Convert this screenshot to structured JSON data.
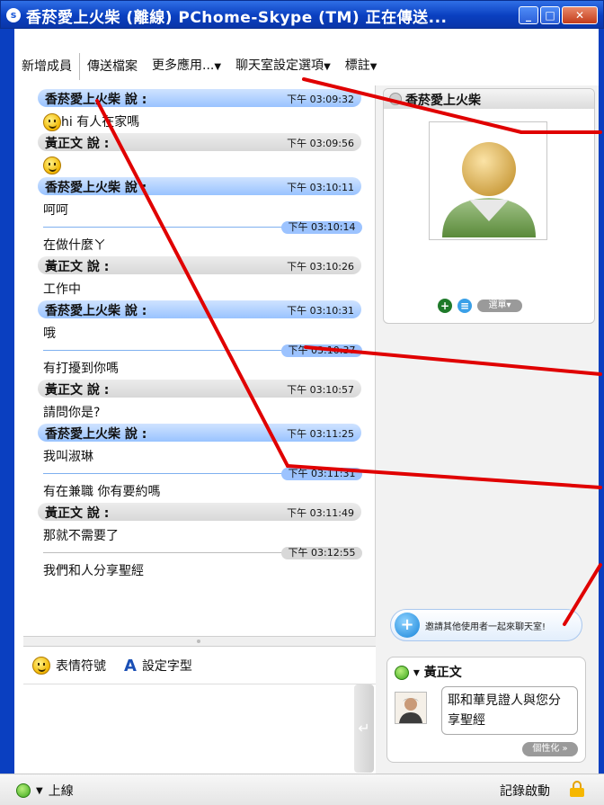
{
  "window": {
    "title": "香菸愛上火柴 (離線) PChome-Skype (TM) 正在傳送..."
  },
  "menu": {
    "items": [
      "新增成員",
      "傳送檔案",
      "更多應用...",
      "聊天室設定選項",
      "標註"
    ]
  },
  "chat": {
    "messages": [
      {
        "kind": "head",
        "side": "me",
        "name": "香菸愛上火柴 說 :",
        "time": "下午 03:09:32"
      },
      {
        "kind": "text",
        "text": "hi   有人在家嗎",
        "emoticon": "smile-icon"
      },
      {
        "kind": "head",
        "side": "other",
        "name": "黃正文 說 :",
        "time": "下午 03:09:56"
      },
      {
        "kind": "emoticon",
        "emoticon": "smile-icon"
      },
      {
        "kind": "head",
        "side": "me",
        "name": "香菸愛上火柴 說 :",
        "time": "下午 03:10:11"
      },
      {
        "kind": "text",
        "text": "呵呵"
      },
      {
        "kind": "cont",
        "time": "下午 03:10:14"
      },
      {
        "kind": "text",
        "text": "在做什麼ㄚ"
      },
      {
        "kind": "head",
        "side": "other",
        "name": "黃正文 說 :",
        "time": "下午 03:10:26"
      },
      {
        "kind": "text",
        "text": "工作中"
      },
      {
        "kind": "head",
        "side": "me",
        "name": "香菸愛上火柴 說 :",
        "time": "下午 03:10:31"
      },
      {
        "kind": "text",
        "text": "哦"
      },
      {
        "kind": "cont",
        "time": "下午 03:10:37"
      },
      {
        "kind": "text",
        "text": "有打擾到你嗎"
      },
      {
        "kind": "head",
        "side": "other",
        "name": "黃正文 說 :",
        "time": "下午 03:10:57"
      },
      {
        "kind": "text",
        "text": "請問你是?"
      },
      {
        "kind": "head",
        "side": "me",
        "name": "香菸愛上火柴 說 :",
        "time": "下午 03:11:25"
      },
      {
        "kind": "text",
        "text": "我叫淑琳"
      },
      {
        "kind": "cont",
        "time": "下午 03:11:31"
      },
      {
        "kind": "text",
        "text": "有在兼職   你有要約嗎"
      },
      {
        "kind": "head",
        "side": "other",
        "name": "黃正文 說 :",
        "time": "下午 03:11:49"
      },
      {
        "kind": "text",
        "text": "那就不需要了"
      },
      {
        "kind": "cont",
        "time": "下午 03:12:55",
        "side": "other"
      },
      {
        "kind": "text",
        "text": "我們和人分享聖經"
      }
    ]
  },
  "input": {
    "emoticon_label": "表情符號",
    "font_label": "設定字型",
    "font_glyph": "A",
    "send_glyph": "↵"
  },
  "profile": {
    "name": "香菸愛上火柴",
    "menu_label": "選單▾"
  },
  "invite": {
    "label": "邀請其他使用者一起來聊天室!"
  },
  "contact": {
    "name": "黃正文",
    "mood": "耶和華見證人與您分享聖經",
    "personal_label": "個性化 »"
  },
  "status": {
    "online_label": "上線",
    "record_label": "記錄啟動"
  },
  "colors": {
    "title_blue": "#0a3fc0",
    "me_header": "#99c3ff",
    "other_header": "#d8d8d8",
    "annotation_red": "#e00000"
  }
}
